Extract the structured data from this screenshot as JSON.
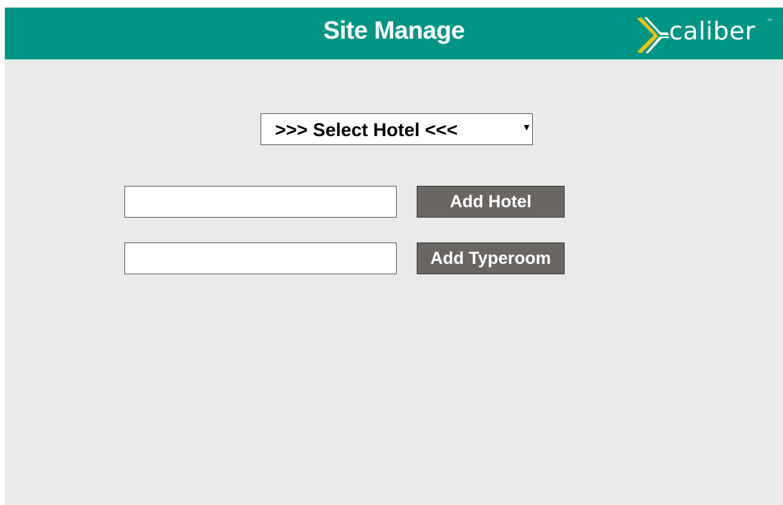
{
  "header": {
    "title": "Site Manage",
    "logo": {
      "name": "xcaliber-logo",
      "text": "caliber",
      "trademark": "™"
    }
  },
  "hotel_select": {
    "selected": ">>> Select Hotel <<<"
  },
  "hotel_form": {
    "input_value": "",
    "button_label": "Add Hotel"
  },
  "typeroom_form": {
    "input_value": "",
    "button_label": "Add Typeroom"
  },
  "colors": {
    "header_bg": "#009686",
    "page_bg": "#e8ebea",
    "button_bg": "#6a6664",
    "logo_accent_yellow": "#f4c20d"
  }
}
